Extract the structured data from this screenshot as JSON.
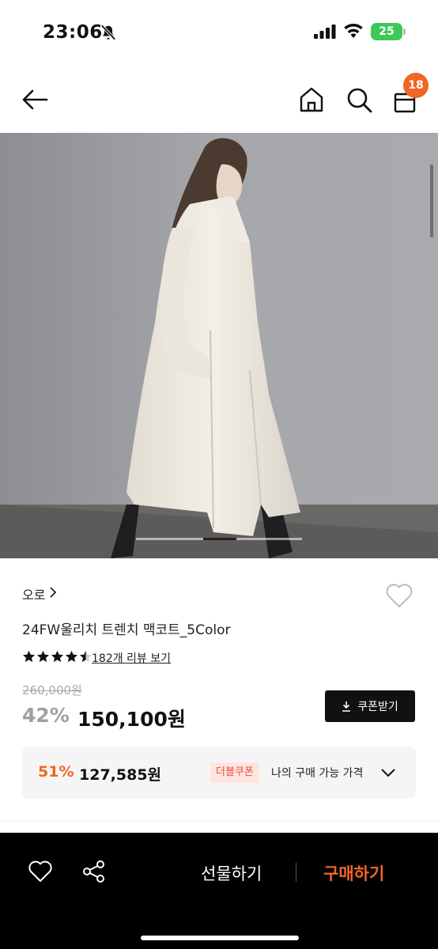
{
  "status_bar": {
    "time": "23:06",
    "battery": "25",
    "icons": [
      "bell-slash-icon",
      "signal-icon",
      "wifi-icon",
      "battery-icon"
    ]
  },
  "nav": {
    "icons": [
      "back-arrow-icon",
      "home-icon",
      "search-icon",
      "shopping-bag-icon"
    ],
    "cart_count": "18"
  },
  "product": {
    "brand": "오로",
    "title": "24FW울리치 트렌치 맥코트_5Color",
    "rating": 4.5,
    "max_rating": 5,
    "reviews_label": "182개 리뷰 보기",
    "original_price": "260,000원",
    "discount": "42%",
    "price": "150,100원",
    "coupon_button": "쿠폰받기",
    "image_pager": {
      "count": 5,
      "active": 3
    }
  },
  "coupon_offer": {
    "discount": "51%",
    "price": "127,585원",
    "badge": "더블쿠폰",
    "label": "나의 구매 가능 가격"
  },
  "bottom_bar": {
    "gift_label": "선물하기",
    "buy_label": "구매하기"
  },
  "colors": {
    "accent": "#f26522",
    "coupon_badge_bg": "#fde5e0",
    "coupon_badge_text": "#f04b3a",
    "bottom_bar_bg": "#000000"
  }
}
